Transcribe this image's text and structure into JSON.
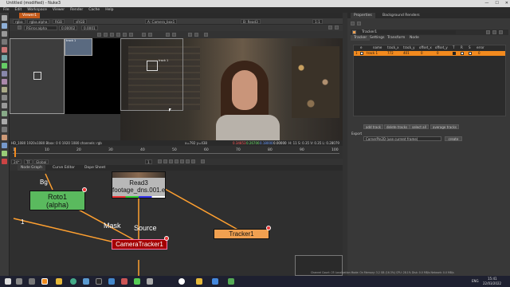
{
  "window": {
    "title": "Untitled (modified) - Nuke3",
    "controls": [
      "—",
      "☐",
      "✕"
    ]
  },
  "menu": [
    "File",
    "Edit",
    "Workspace",
    "Viewer",
    "Render",
    "Cache",
    "Help"
  ],
  "viewer": {
    "tab": "Viewer1",
    "ctrl1": {
      "layer": "rgba",
      "channel": "rgba.alpha",
      "colorspace": "RGB",
      "gamma_label": "sRGB",
      "input": "A: Camera_box1",
      "input_b": "B: Read3",
      "zoom": "1:1"
    },
    "ctrl2": {
      "overlay": "P.Error.alpha",
      "value": "0.00002",
      "value2": "0.0001"
    },
    "status_left": "HD_1080 1920x1080  Bbox: 0 0 1920 1080 channels: rgb",
    "status_mid": "x=792 y=438",
    "status_vals": [
      "0.34853",
      "0.26706",
      "0.18000",
      "0.00000"
    ],
    "status_right": "H: 11  S: 0.35  V: 0.35  L: 0.28079",
    "timeline_ticks": [
      "1",
      "10",
      "20",
      "30",
      "40",
      "50",
      "60",
      "70",
      "80",
      "90",
      "100"
    ],
    "frame": "1",
    "fps": "24*",
    "tf_mode": "TF",
    "tf_scope": "Global",
    "overlay_labels": {
      "track1": "track 1",
      "pattern_label": "track 1"
    }
  },
  "nodegraph": {
    "tabs": [
      "Node Graph",
      "Curve Editor",
      "Dope Sheet"
    ],
    "nodes": {
      "roto": {
        "line1": "Roto1",
        "line2": "(alpha)"
      },
      "read": {
        "line1": "Read3",
        "line2": "footage_dns.001.exr"
      },
      "camtracker": {
        "label": "CameraTracker1"
      },
      "tracker": {
        "label": "Tracker1"
      }
    },
    "pipe_labels": {
      "bg": "Bg",
      "mask": "Mask",
      "source": "Source",
      "one": "1"
    },
    "status": "Channel Count: 25  Localization Mode: On  Memory: 3.2 GB (16.3%)  CPU: 28.1%  Disk: 0.0 MB/s  Network: 0.0 MB/s"
  },
  "properties": {
    "tabs": [
      "Properties",
      "Background Renders"
    ],
    "node_name": "Tracker1",
    "subtabs": [
      "Tracker",
      "Settings",
      "Transform",
      "Node"
    ],
    "table_headers": [
      "e",
      "name",
      "track_x",
      "track_y",
      "offset_x",
      "offset_y",
      "T",
      "R",
      "S",
      "error"
    ],
    "rows": [
      {
        "num": "1",
        "name": "track 1",
        "track_x": "772",
        "track_y": "401",
        "offset_x": "0",
        "offset_y": "0",
        "error": "0"
      }
    ],
    "buttons": [
      "add track",
      "delete tracks",
      "select all",
      "average tracks"
    ],
    "export_label": "Export",
    "export_value": "CornerPin2D (use current frame)",
    "create_label": "create"
  },
  "taskbar": {
    "time": "15:41",
    "date": "22/03/2022",
    "lang": "ENG"
  },
  "colors": {
    "roto": "#5aba5e",
    "read": "#b8b8b8",
    "camtracker": "#a30000",
    "tracker": "#f0a050",
    "pipe": "#ffa030",
    "highlight": "#f28a1e"
  }
}
